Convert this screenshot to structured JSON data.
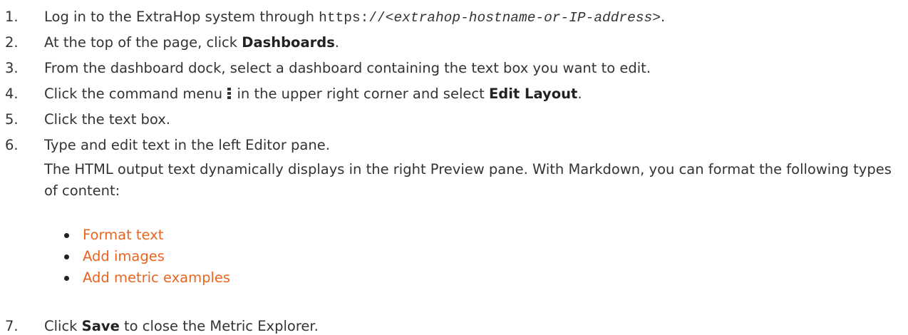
{
  "steps": [
    {
      "num": "1.",
      "pre": "Log in to the ExtraHop system through ",
      "code": "https://",
      "code_italic": "<extrahop-hostname-or-IP-address>",
      "post": "."
    },
    {
      "num": "2.",
      "pre": "At the top of the page, click ",
      "bold": "Dashboards",
      "post": "."
    },
    {
      "num": "3.",
      "text": "From the dashboard dock, select a dashboard containing the text box you want to edit."
    },
    {
      "num": "4.",
      "pre": "Click the command menu ",
      "mid": " in the upper right corner and select ",
      "bold": "Edit Layout",
      "post": ".",
      "icon": "command-menu-icon"
    },
    {
      "num": "5.",
      "text": "Click the text box."
    },
    {
      "num": "6.",
      "text": "Type and edit text in the left Editor pane.",
      "para": "The HTML output text dynamically displays in the right Preview pane. With Markdown, you can format the following types of content:"
    },
    {
      "num": "7.",
      "pre": "Click ",
      "bold": "Save",
      "post": " to close the Metric Explorer."
    }
  ],
  "links": [
    "Format text",
    "Add images",
    "Add metric examples"
  ],
  "colors": {
    "text": "#333333",
    "link": "#e8651f"
  }
}
